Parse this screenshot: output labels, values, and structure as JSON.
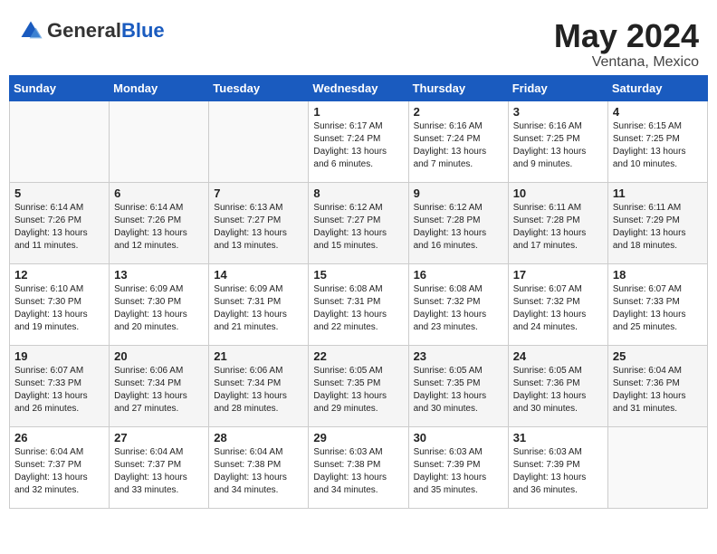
{
  "header": {
    "logo_general": "General",
    "logo_blue": "Blue",
    "month_year": "May 2024",
    "location": "Ventana, Mexico"
  },
  "days_of_week": [
    "Sunday",
    "Monday",
    "Tuesday",
    "Wednesday",
    "Thursday",
    "Friday",
    "Saturday"
  ],
  "weeks": [
    [
      {
        "day": "",
        "info": ""
      },
      {
        "day": "",
        "info": ""
      },
      {
        "day": "",
        "info": ""
      },
      {
        "day": "1",
        "info": "Sunrise: 6:17 AM\nSunset: 7:24 PM\nDaylight: 13 hours and 6 minutes."
      },
      {
        "day": "2",
        "info": "Sunrise: 6:16 AM\nSunset: 7:24 PM\nDaylight: 13 hours and 7 minutes."
      },
      {
        "day": "3",
        "info": "Sunrise: 6:16 AM\nSunset: 7:25 PM\nDaylight: 13 hours and 9 minutes."
      },
      {
        "day": "4",
        "info": "Sunrise: 6:15 AM\nSunset: 7:25 PM\nDaylight: 13 hours and 10 minutes."
      }
    ],
    [
      {
        "day": "5",
        "info": "Sunrise: 6:14 AM\nSunset: 7:26 PM\nDaylight: 13 hours and 11 minutes."
      },
      {
        "day": "6",
        "info": "Sunrise: 6:14 AM\nSunset: 7:26 PM\nDaylight: 13 hours and 12 minutes."
      },
      {
        "day": "7",
        "info": "Sunrise: 6:13 AM\nSunset: 7:27 PM\nDaylight: 13 hours and 13 minutes."
      },
      {
        "day": "8",
        "info": "Sunrise: 6:12 AM\nSunset: 7:27 PM\nDaylight: 13 hours and 15 minutes."
      },
      {
        "day": "9",
        "info": "Sunrise: 6:12 AM\nSunset: 7:28 PM\nDaylight: 13 hours and 16 minutes."
      },
      {
        "day": "10",
        "info": "Sunrise: 6:11 AM\nSunset: 7:28 PM\nDaylight: 13 hours and 17 minutes."
      },
      {
        "day": "11",
        "info": "Sunrise: 6:11 AM\nSunset: 7:29 PM\nDaylight: 13 hours and 18 minutes."
      }
    ],
    [
      {
        "day": "12",
        "info": "Sunrise: 6:10 AM\nSunset: 7:30 PM\nDaylight: 13 hours and 19 minutes."
      },
      {
        "day": "13",
        "info": "Sunrise: 6:09 AM\nSunset: 7:30 PM\nDaylight: 13 hours and 20 minutes."
      },
      {
        "day": "14",
        "info": "Sunrise: 6:09 AM\nSunset: 7:31 PM\nDaylight: 13 hours and 21 minutes."
      },
      {
        "day": "15",
        "info": "Sunrise: 6:08 AM\nSunset: 7:31 PM\nDaylight: 13 hours and 22 minutes."
      },
      {
        "day": "16",
        "info": "Sunrise: 6:08 AM\nSunset: 7:32 PM\nDaylight: 13 hours and 23 minutes."
      },
      {
        "day": "17",
        "info": "Sunrise: 6:07 AM\nSunset: 7:32 PM\nDaylight: 13 hours and 24 minutes."
      },
      {
        "day": "18",
        "info": "Sunrise: 6:07 AM\nSunset: 7:33 PM\nDaylight: 13 hours and 25 minutes."
      }
    ],
    [
      {
        "day": "19",
        "info": "Sunrise: 6:07 AM\nSunset: 7:33 PM\nDaylight: 13 hours and 26 minutes."
      },
      {
        "day": "20",
        "info": "Sunrise: 6:06 AM\nSunset: 7:34 PM\nDaylight: 13 hours and 27 minutes."
      },
      {
        "day": "21",
        "info": "Sunrise: 6:06 AM\nSunset: 7:34 PM\nDaylight: 13 hours and 28 minutes."
      },
      {
        "day": "22",
        "info": "Sunrise: 6:05 AM\nSunset: 7:35 PM\nDaylight: 13 hours and 29 minutes."
      },
      {
        "day": "23",
        "info": "Sunrise: 6:05 AM\nSunset: 7:35 PM\nDaylight: 13 hours and 30 minutes."
      },
      {
        "day": "24",
        "info": "Sunrise: 6:05 AM\nSunset: 7:36 PM\nDaylight: 13 hours and 30 minutes."
      },
      {
        "day": "25",
        "info": "Sunrise: 6:04 AM\nSunset: 7:36 PM\nDaylight: 13 hours and 31 minutes."
      }
    ],
    [
      {
        "day": "26",
        "info": "Sunrise: 6:04 AM\nSunset: 7:37 PM\nDaylight: 13 hours and 32 minutes."
      },
      {
        "day": "27",
        "info": "Sunrise: 6:04 AM\nSunset: 7:37 PM\nDaylight: 13 hours and 33 minutes."
      },
      {
        "day": "28",
        "info": "Sunrise: 6:04 AM\nSunset: 7:38 PM\nDaylight: 13 hours and 34 minutes."
      },
      {
        "day": "29",
        "info": "Sunrise: 6:03 AM\nSunset: 7:38 PM\nDaylight: 13 hours and 34 minutes."
      },
      {
        "day": "30",
        "info": "Sunrise: 6:03 AM\nSunset: 7:39 PM\nDaylight: 13 hours and 35 minutes."
      },
      {
        "day": "31",
        "info": "Sunrise: 6:03 AM\nSunset: 7:39 PM\nDaylight: 13 hours and 36 minutes."
      },
      {
        "day": "",
        "info": ""
      }
    ]
  ]
}
